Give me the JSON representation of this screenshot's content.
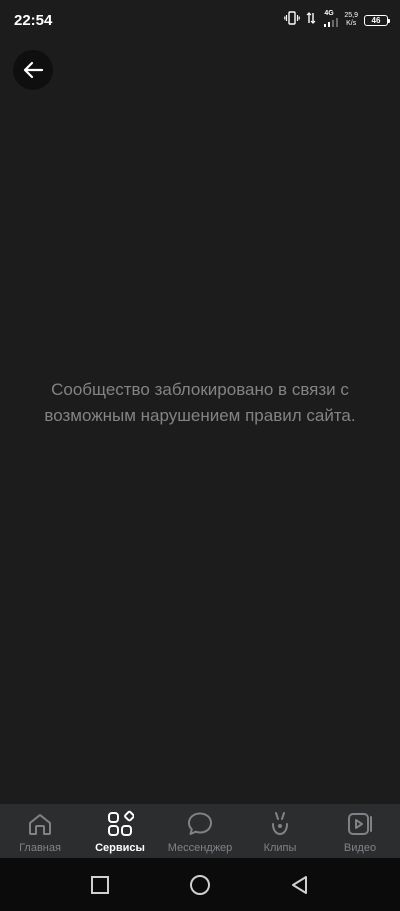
{
  "status_bar": {
    "time": "22:54",
    "network_type": "4G",
    "net_speed_value": "25,9",
    "net_speed_unit": "K/s",
    "battery": "46"
  },
  "content": {
    "message": "Сообщество заблокировано в связи с возможным нарушением правил сайта."
  },
  "tab_bar": {
    "items": [
      {
        "label": "Главная",
        "icon": "home-icon",
        "active": false
      },
      {
        "label": "Сервисы",
        "icon": "services-icon",
        "active": true
      },
      {
        "label": "Мессенджер",
        "icon": "messenger-icon",
        "active": false
      },
      {
        "label": "Клипы",
        "icon": "clips-icon",
        "active": false
      },
      {
        "label": "Видео",
        "icon": "video-icon",
        "active": false
      }
    ]
  },
  "system_nav": {
    "buttons": [
      "recents-icon",
      "home-circle-icon",
      "back-triangle-icon"
    ]
  },
  "colors": {
    "background": "#1c1c1d",
    "tab_bar": "#2c2d2e",
    "inactive": "#818285",
    "active": "#ffffff",
    "message_text": "#828385"
  }
}
